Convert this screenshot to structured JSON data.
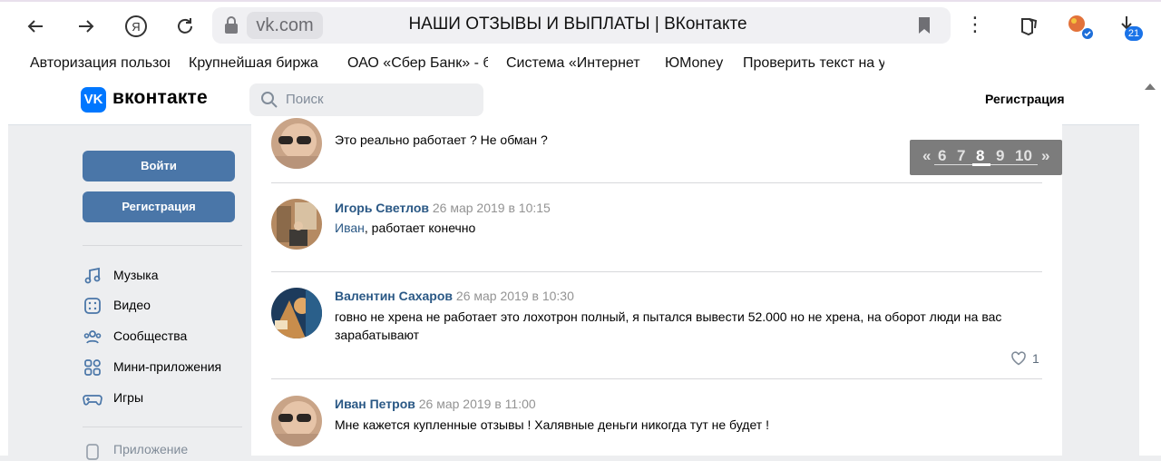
{
  "browser": {
    "domain": "vk.com",
    "tab_title": "НАШИ ОТЗЫВЫ И ВЫПЛАТЫ | ВКонтакте",
    "downloads_badge": "21",
    "bookmarks": [
      "Авторизация пользов",
      "Крупнейшая биржа",
      "ОАО «Сбер Банк» - б",
      "Система «Интернет",
      "ЮMoney",
      "Проверить текст на у"
    ]
  },
  "header": {
    "logo_mark": "VK",
    "logo_text": "вконтакте",
    "search_placeholder": "Поиск",
    "register_link": "Регистрация"
  },
  "sidebar": {
    "login_button": "Войти",
    "register_button": "Регистрация",
    "menu": [
      {
        "label": "Музыка",
        "icon": "music-icon"
      },
      {
        "label": "Видео",
        "icon": "video-icon"
      },
      {
        "label": "Сообщества",
        "icon": "communities-icon"
      },
      {
        "label": "Мини-приложения",
        "icon": "mini-apps-icon"
      },
      {
        "label": "Игры",
        "icon": "games-icon"
      }
    ],
    "app_item": "Приложение"
  },
  "pager": {
    "prev": "«",
    "pages": [
      "6",
      "7",
      "8",
      "9",
      "10"
    ],
    "current": "8",
    "next": "»"
  },
  "comments": [
    {
      "author": "",
      "time": "",
      "text": "Это реально работает ? Не обман ?",
      "reply_to": ""
    },
    {
      "author": "Игорь Светлов",
      "time": "26 мар 2019 в 10:15",
      "reply_to": "Иван",
      "text": ", работает конечно"
    },
    {
      "author": "Валентин Сахаров",
      "time": "26 мар 2019 в 10:30",
      "reply_to": "",
      "text": "говно не хрена не работает это лохотрон полный, я пытался вывести 52.000 но не хрена, на оборот люди на вас зарабатывают",
      "likes": "1"
    },
    {
      "author": "Иван Петров",
      "time": "26 мар 2019 в 11:00",
      "reply_to": "",
      "text": "Мне кажется купленные отзывы ! Халявные деньги никогда тут не будет !"
    }
  ]
}
